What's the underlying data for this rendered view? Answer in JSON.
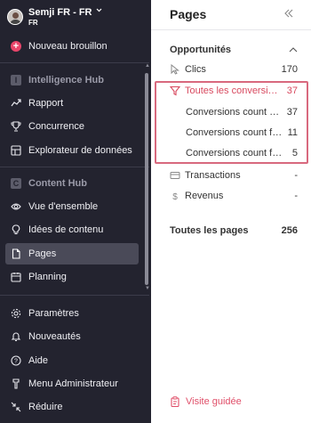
{
  "account": {
    "name": "Semji FR - FR",
    "sub": "FR"
  },
  "sidebar": {
    "new_draft": "Nouveau brouillon",
    "section1": {
      "badge": "I",
      "label": "Intelligence Hub"
    },
    "items1": [
      {
        "label": "Rapport",
        "icon": "chart-line-icon"
      },
      {
        "label": "Concurrence",
        "icon": "trophy-icon"
      },
      {
        "label": "Explorateur de données",
        "icon": "explorer-icon"
      }
    ],
    "section2": {
      "badge": "C",
      "label": "Content Hub"
    },
    "items2": [
      {
        "label": "Vue d'ensemble",
        "icon": "eye-icon"
      },
      {
        "label": "Idées de contenu",
        "icon": "lightbulb-icon"
      },
      {
        "label": "Pages",
        "icon": "page-icon",
        "active": true
      },
      {
        "label": "Planning",
        "icon": "calendar-icon"
      }
    ],
    "bottom": [
      {
        "label": "Paramètres",
        "icon": "gear-icon"
      },
      {
        "label": "Nouveautés",
        "icon": "bell-icon"
      },
      {
        "label": "Aide",
        "icon": "help-icon"
      },
      {
        "label": "Menu Administrateur",
        "icon": "admin-icon"
      },
      {
        "label": "Réduire",
        "icon": "collapse-icon"
      }
    ]
  },
  "panel": {
    "title": "Pages",
    "opportunities": "Opportunités",
    "rows": {
      "clics": {
        "label": "Clics",
        "value": "170"
      },
      "conversions": {
        "label": "Toutes les conversions",
        "value": "37"
      },
      "sub1": {
        "label": "Conversions count for ...",
        "value": "37"
      },
      "sub2": {
        "label": "Conversions count for ...",
        "value": "11"
      },
      "sub3": {
        "label": "Conversions count for ...",
        "value": "5"
      },
      "transactions": {
        "label": "Transactions",
        "value": "-"
      },
      "revenus": {
        "label": "Revenus",
        "value": "-"
      },
      "all_pages": {
        "label": "Toutes les pages",
        "value": "256"
      }
    },
    "guide": "Visite guidée"
  },
  "colors": {
    "sidebar_bg": "#23232f",
    "accent": "#e8456a",
    "highlight": "#d8697e"
  }
}
